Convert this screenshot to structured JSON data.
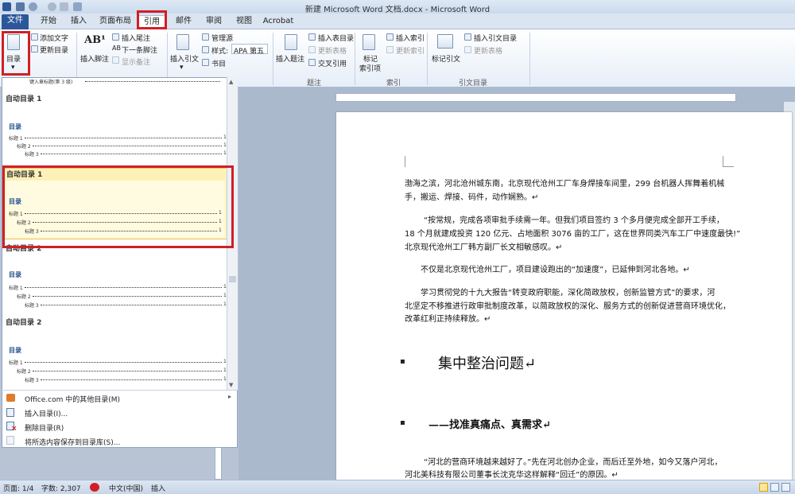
{
  "window": {
    "title": "新建 Microsoft Word 文档.docx - Microsoft Word"
  },
  "tabs": [
    "文件",
    "开始",
    "插入",
    "页面布局",
    "引用",
    "邮件",
    "审阅",
    "视图",
    "Acrobat"
  ],
  "ribbon": {
    "toc_btn": "目录",
    "add_text": "添加文字",
    "update_toc": "更新目录",
    "insert_footnote_big": "插入脚注",
    "insert_endnote": "插入尾注",
    "next_footnote": "下一条脚注",
    "show_notes": "显示备注",
    "insert_citation": "插入引文",
    "manage_sources": "管理源",
    "style_label": "样式:",
    "style_value": "APA 第五",
    "bibliography": "书目",
    "insert_caption": "插入题注",
    "insert_table_figures": "插入表目录",
    "update_table": "更新表格",
    "cross_ref": "交叉引用",
    "mark_entry_1": "标记",
    "mark_entry_2": "索引项",
    "insert_index": "插入索引",
    "update_index": "更新索引",
    "mark_citation": "标记引文",
    "insert_toa": "插入引文目录",
    "update_toa": "更新表格",
    "group_caption": "题注",
    "group_index": "索引",
    "group_toa": "引文目录"
  },
  "gallery": {
    "top_item": "键入章标题(第 3 级)",
    "sections": [
      {
        "name": "自动目录 1",
        "toc_title": "目录",
        "levels": [
          "标题 1",
          "标题 2",
          "标题 3"
        ],
        "level_nums": [
          "1",
          "1",
          "1"
        ]
      },
      {
        "name": "自动目录 1",
        "toc_title": "目录",
        "levels": [
          "标题 1",
          "标题 2",
          "标题 3"
        ],
        "level_nums": [
          "1",
          "1",
          "1"
        ]
      },
      {
        "name": "自动目录 2",
        "toc_title": "目录",
        "levels": [
          "标题 1",
          "标题 2",
          "标题 3"
        ],
        "level_nums": [
          "1",
          "1",
          "1"
        ]
      },
      {
        "name": "自动目录 2",
        "toc_title": "目录",
        "levels": [
          "标题 1",
          "标题 2",
          "标题 3"
        ],
        "level_nums": [
          "1",
          "1",
          "1"
        ]
      }
    ],
    "menu": {
      "more_toc": "Office.com 中的其他目录(M)",
      "insert_toc": "插入目录(I)...",
      "remove_toc": "删除目录(R)",
      "save_selection": "将所选内容保存到目录库(S)..."
    }
  },
  "document": {
    "p1a": "渤海之滨，河北沧州城东南，北京现代沧州工厂车身焊接车间里，299 台机器人挥舞着机械",
    "p1b": "手，搬运、焊接、码件，动作娴熟。↵",
    "p2a": "“按常规，完成各项审批手续需一年。但我们项目签约 3 个多月便完成全部开工手续，",
    "p2b": "18 个月就建成投资 120 亿元、占地面积 3076 亩的工厂，这在世界同类汽车工厂中速度最快!”",
    "p2c": "北京现代沧州工厂韩方副厂长文相敏感叹。↵",
    "p3": "不仅是北京现代沧州工厂，项目建设跑出的“加速度”，已延伸到河北各地。↵",
    "p4a": "学习贯彻党的十九大报告“转变政府职能，深化简政放权，创新监管方式”的要求，河",
    "p4b": "北坚定不移推进行政审批制度改革，以简政放权的深化、服务方式的创新促进营商环境优化，",
    "p4c": "改革红利正持续释放。↵",
    "h1": "集中整治问题↵",
    "h2": "——找准真痛点、真需求↵",
    "p5a": "“河北的营商环境越来越好了。”先在河北创办企业，而后迁至外地，如今又落户河北，",
    "p5b": "河北美科技有限公司董事长沈克华这样解释“回迁”的原因。↵"
  },
  "status": {
    "page": "页面: 1/4",
    "words": "字数: 2,307",
    "lang": "中文(中国)",
    "mode": "插入"
  }
}
